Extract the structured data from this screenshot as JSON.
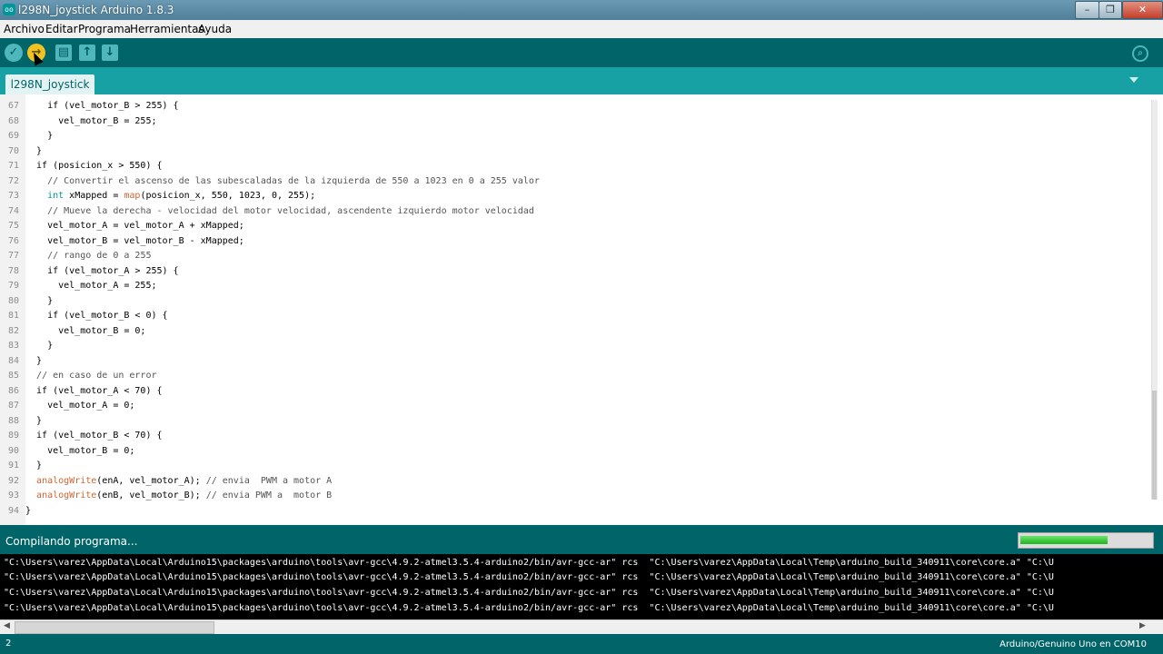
{
  "window": {
    "title": "l298N_joystick Arduino 1.8.3",
    "icon_text": "oo",
    "controls": [
      "–",
      "❐",
      "✕"
    ]
  },
  "menu": [
    "Archivo",
    "Editar",
    "Programa",
    "Herramientas",
    "Ayuda"
  ],
  "toolbar": {
    "buttons": [
      "verify-icon",
      "upload-icon",
      "new-icon",
      "open-icon",
      "save-icon",
      "serial-monitor-icon"
    ],
    "glyphs": [
      "✓",
      "→",
      "▤",
      "↑",
      "↓",
      "⌕"
    ]
  },
  "tab": {
    "label": "l298N_joystick",
    "menu_icon": "chevron-down-icon"
  },
  "editor": {
    "lines": [
      {
        "n": "67",
        "t": "    if (vel_motor_B > 255) {"
      },
      {
        "n": "68",
        "t": "      vel_motor_B = 255;"
      },
      {
        "n": "69",
        "t": "    }"
      },
      {
        "n": "70",
        "t": "  }"
      },
      {
        "n": "71",
        "t": "  if (posicion_x > 550) {"
      },
      {
        "n": "72",
        "t": "    // Convertir el ascenso de las subescaladas de la izquierda de 550 a 1023 en 0 a 255 valor"
      },
      {
        "n": "73",
        "t": "    int xMapped = map(posicion_x, 550, 1023, 0, 255);"
      },
      {
        "n": "74",
        "t": "    // Mueve la derecha - velocidad del motor velocidad, ascendente izquierdo motor velocidad"
      },
      {
        "n": "75",
        "t": "    vel_motor_A = vel_motor_A + xMapped;"
      },
      {
        "n": "76",
        "t": "    vel_motor_B = vel_motor_B - xMapped;"
      },
      {
        "n": "77",
        "t": "    // rango de 0 a 255"
      },
      {
        "n": "78",
        "t": "    if (vel_motor_A > 255) {"
      },
      {
        "n": "79",
        "t": "      vel_motor_A = 255;"
      },
      {
        "n": "80",
        "t": "    }"
      },
      {
        "n": "81",
        "t": "    if (vel_motor_B < 0) {"
      },
      {
        "n": "82",
        "t": "      vel_motor_B = 0;"
      },
      {
        "n": "83",
        "t": "    }"
      },
      {
        "n": "84",
        "t": "  }"
      },
      {
        "n": "85",
        "t": "  // en caso de un error"
      },
      {
        "n": "86",
        "t": "  if (vel_motor_A < 70) {"
      },
      {
        "n": "87",
        "t": "    vel_motor_A = 0;"
      },
      {
        "n": "88",
        "t": "  }"
      },
      {
        "n": "89",
        "t": "  if (vel_motor_B < 70) {"
      },
      {
        "n": "90",
        "t": "    vel_motor_B = 0;"
      },
      {
        "n": "91",
        "t": "  }"
      },
      {
        "n": "92",
        "t": "  analogWrite(enA, vel_motor_A); // envia  PWM a motor A"
      },
      {
        "n": "93",
        "t": "  analogWrite(enB, vel_motor_B); // envia PWM a  motor B"
      },
      {
        "n": "94",
        "t": "}"
      }
    ]
  },
  "status": {
    "message": "Compilando programa...",
    "progress": 0.67
  },
  "console": {
    "lines": [
      "\"C:\\Users\\varez\\AppData\\Local\\Arduino15\\packages\\arduino\\tools\\avr-gcc\\4.9.2-atmel3.5.4-arduino2/bin/avr-gcc-ar\" rcs  \"C:\\Users\\varez\\AppData\\Local\\Temp\\arduino_build_340911\\core\\core.a\" \"C:\\U",
      "\"C:\\Users\\varez\\AppData\\Local\\Arduino15\\packages\\arduino\\tools\\avr-gcc\\4.9.2-atmel3.5.4-arduino2/bin/avr-gcc-ar\" rcs  \"C:\\Users\\varez\\AppData\\Local\\Temp\\arduino_build_340911\\core\\core.a\" \"C:\\U",
      "\"C:\\Users\\varez\\AppData\\Local\\Arduino15\\packages\\arduino\\tools\\avr-gcc\\4.9.2-atmel3.5.4-arduino2/bin/avr-gcc-ar\" rcs  \"C:\\Users\\varez\\AppData\\Local\\Temp\\arduino_build_340911\\core\\core.a\" \"C:\\U",
      "\"C:\\Users\\varez\\AppData\\Local\\Arduino15\\packages\\arduino\\tools\\avr-gcc\\4.9.2-atmel3.5.4-arduino2/bin/avr-gcc-ar\" rcs  \"C:\\Users\\varez\\AppData\\Local\\Temp\\arduino_build_340911\\core\\core.a\" \"C:\\U"
    ]
  },
  "footer": {
    "line_number": "2",
    "board": "Arduino/Genuino Uno en COM10"
  },
  "colors": {
    "toolbar": "#006468",
    "tabbar": "#17a1a5",
    "upload": "#f0c322",
    "keyword": "#cc6633",
    "type": "#00979c"
  }
}
